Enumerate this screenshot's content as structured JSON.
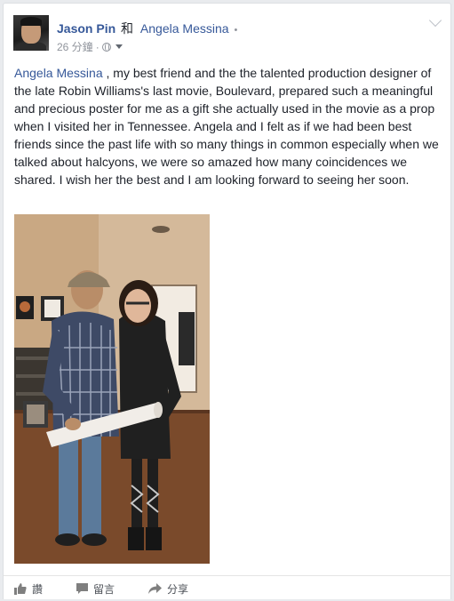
{
  "post": {
    "author": "Jason Pin",
    "with_word": "和",
    "tagged_friend": "Angela Messina",
    "time": "26 分鐘",
    "separator": "·",
    "text_tag": "Angela Messina",
    "text_body": " , my best friend and the the talented production designer of the late Robin Williams's last movie, Boulevard, prepared such a meaningful and precious poster for me as a gift she actually used in the movie as a prop when I visited her in Tennessee. Angela and I felt as if we had been best friends since the past life with so many things in common especially when we talked about halcyons, we were so amazed how many coincidences we shared. I wish her the best and I am looking forward to seeing her soon."
  },
  "actions": {
    "like": "讚",
    "comment": "留言",
    "share": "分享"
  },
  "icons": {
    "privacy": "globe-icon",
    "audience_menu": "caret-icon",
    "options": "chevron-down-icon",
    "like": "thumbs-up-icon",
    "comment": "speech-bubble-icon",
    "share": "share-arrow-icon"
  },
  "colors": {
    "link": "#365899",
    "text": "#1d2129",
    "meta": "#90949c"
  }
}
